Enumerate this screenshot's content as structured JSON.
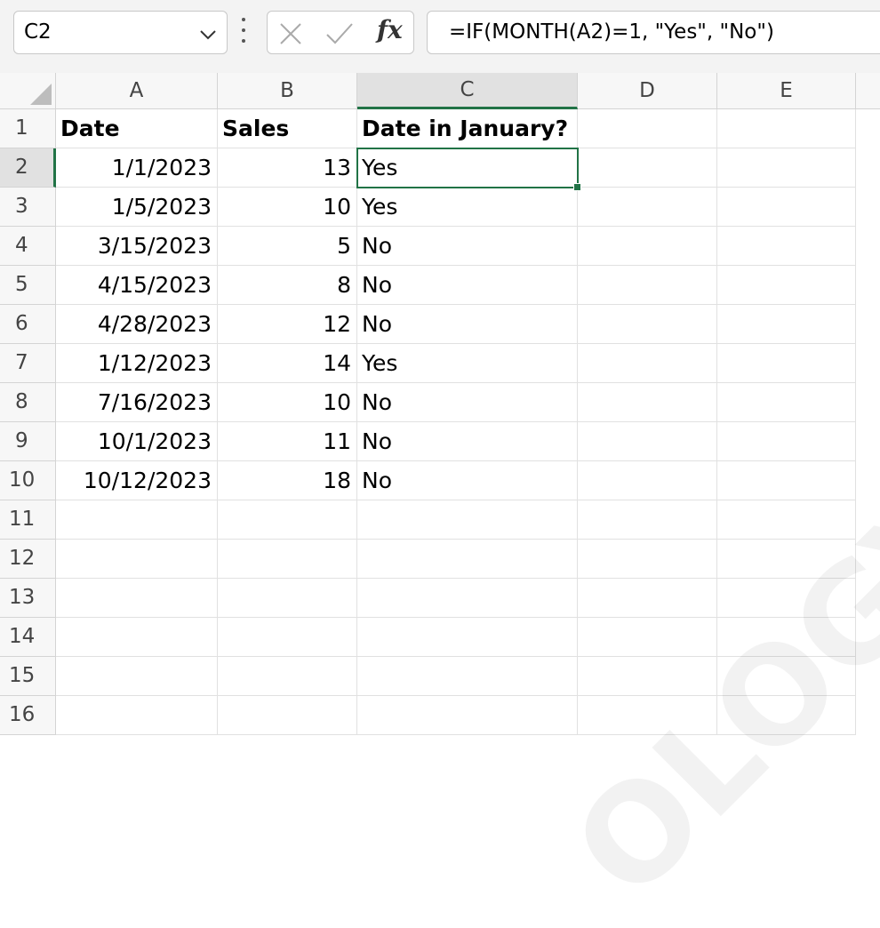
{
  "formula_bar": {
    "name_box": "C2",
    "fx_label": "fx",
    "formula": "=IF(MONTH(A2)=1, \"Yes\", \"No\")"
  },
  "columns": [
    "A",
    "B",
    "C",
    "D",
    "E"
  ],
  "rows": [
    "1",
    "2",
    "3",
    "4",
    "5",
    "6",
    "7",
    "8",
    "9",
    "10",
    "11",
    "12",
    "13",
    "14",
    "15",
    "16"
  ],
  "headers": {
    "a": "Date",
    "b": "Sales",
    "c": "Date in January?"
  },
  "data": [
    {
      "date": "1/1/2023",
      "sales": "13",
      "jan": "Yes"
    },
    {
      "date": "1/5/2023",
      "sales": "10",
      "jan": "Yes"
    },
    {
      "date": "3/15/2023",
      "sales": "5",
      "jan": "No"
    },
    {
      "date": "4/15/2023",
      "sales": "8",
      "jan": "No"
    },
    {
      "date": "4/28/2023",
      "sales": "12",
      "jan": "No"
    },
    {
      "date": "1/12/2023",
      "sales": "14",
      "jan": "Yes"
    },
    {
      "date": "7/16/2023",
      "sales": "10",
      "jan": "No"
    },
    {
      "date": "10/1/2023",
      "sales": "11",
      "jan": "No"
    },
    {
      "date": "10/12/2023",
      "sales": "18",
      "jan": "No"
    }
  ],
  "selection": {
    "cell": "C2",
    "accent": "#217346"
  },
  "watermark": "OLOGY.C"
}
